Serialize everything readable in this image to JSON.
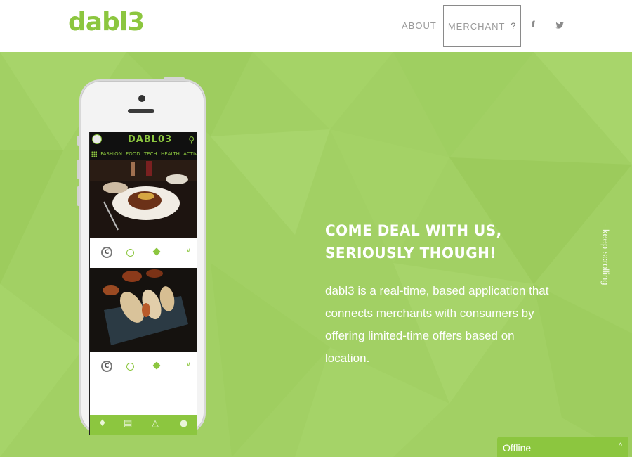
{
  "header": {
    "logo_text": "dabl3",
    "nav_about": "ABOUT",
    "nav_merchant": "MERCHANT",
    "nav_merchant_q": "?",
    "facebook": "f",
    "twitter": "twitter"
  },
  "hero": {
    "headline_line1": "COME DEAL WITH US,",
    "headline_line2": "SERIOUSLY THOUGH!",
    "body": "dabl3 is a real-time, based application that connects merchants with consumers by offering limited-time offers based on location.",
    "scroll_hint": "- keep scrolling -"
  },
  "phone_app": {
    "logo": "DABL03",
    "categories": [
      "FASHION",
      "FOOD",
      "TECH",
      "HEALTH",
      "ACTIVITIES"
    ],
    "cards": [
      {
        "brand": "C"
      },
      {
        "brand": "C"
      }
    ]
  },
  "chat": {
    "status": "Offline",
    "caret": "^"
  },
  "colors": {
    "brand_green": "#8cc63f",
    "hero_bg": "#a2d064",
    "text_gray": "#9a9a9a"
  }
}
